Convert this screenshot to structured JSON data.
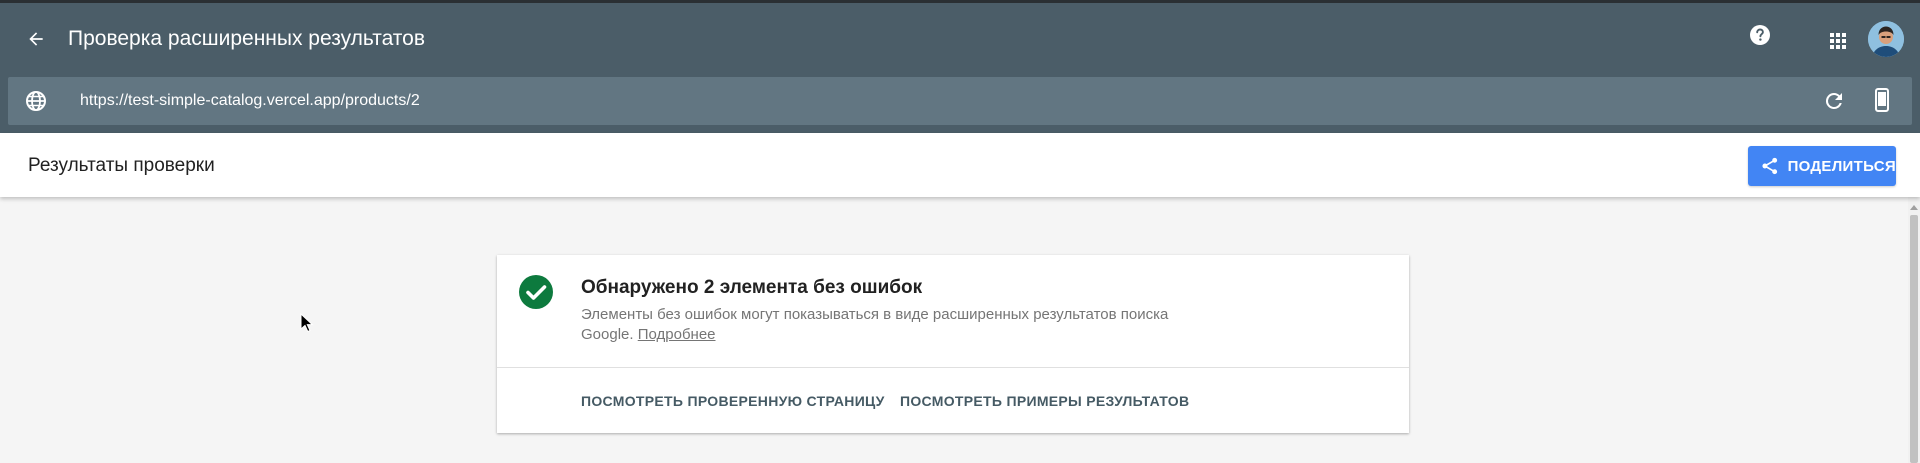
{
  "appbar": {
    "title": "Проверка расширенных результатов",
    "back_icon": "arrow-back-icon",
    "help_icon": "help-icon",
    "apps_icon": "apps-grid-icon",
    "avatar_icon": "user-avatar"
  },
  "urlbar": {
    "url": "https://test-simple-catalog.vercel.app/products/2",
    "globe_icon": "globe-icon",
    "reload_icon": "reload-icon",
    "device_icon": "smartphone-icon"
  },
  "subheader": {
    "title": "Результаты проверки",
    "share_label": "ПОДЕЛИТЬСЯ",
    "share_icon": "share-icon"
  },
  "result_card": {
    "title": "Обнаружено 2 элемента без ошибок",
    "description": "Элементы без ошибок могут показываться в виде расширенных результатов поиска Google. ",
    "learn_more": "Подробнее",
    "action_view_page": "ПОСМОТРЕТЬ ПРОВЕРЕННУЮ СТРАНИЦУ",
    "action_view_examples": "ПОСМОТРЕТЬ ПРИМЕРЫ РЕЗУЛЬТАТОВ",
    "status_icon": "check-circle-icon"
  },
  "colors": {
    "appbar": "#4b5d68",
    "urlbar": "#627682",
    "accent": "#4285f4",
    "success": "#0d7a3e"
  }
}
